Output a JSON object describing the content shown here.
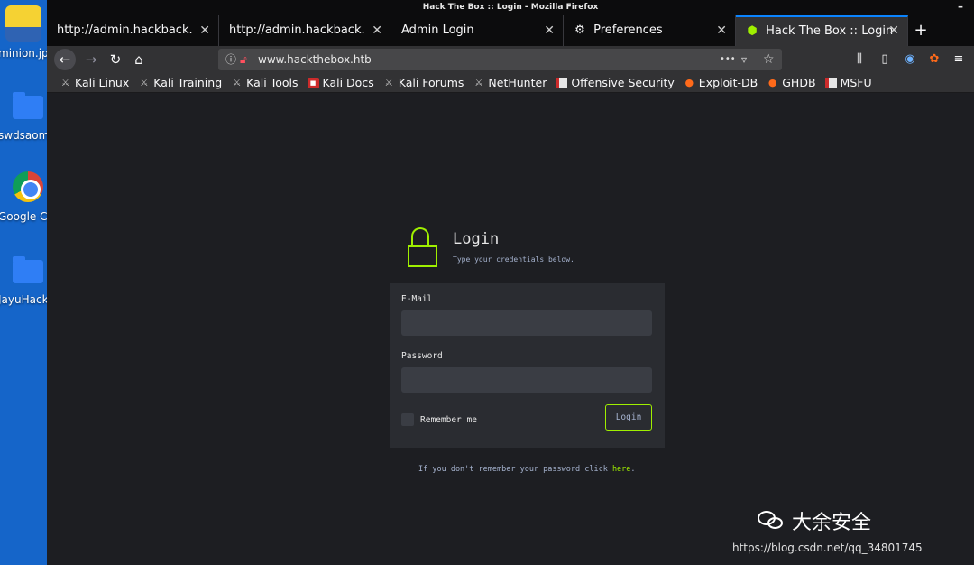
{
  "desktop": {
    "icons": [
      {
        "label": "minion.jp",
        "icon": "minion-image-icon"
      },
      {
        "label": "swdsaom",
        "icon": "folder-icon"
      },
      {
        "label": "Google Ch",
        "icon": "chrome-icon"
      },
      {
        "label": "JayuHack",
        "icon": "folder-icon"
      }
    ]
  },
  "window": {
    "title": "Hack The Box :: Login - Mozilla Firefox",
    "minimize": "–"
  },
  "tabs": [
    {
      "label": "http://admin.hackback.htb/p",
      "close": "✕"
    },
    {
      "label": "http://admin.hackback.htb/",
      "close": "✕"
    },
    {
      "label": "Admin Login",
      "close": "✕"
    },
    {
      "label": "Preferences",
      "close": "✕",
      "icon": "gear-icon"
    },
    {
      "label": "Hack The Box :: Login",
      "close": "✕",
      "active": true,
      "icon": "htb-icon"
    }
  ],
  "new_tab": "+",
  "nav": {
    "url": "www.hackthebox.htb",
    "back": "←",
    "forward": "→",
    "reload": "↻",
    "home": "⌂",
    "page_actions": "•••",
    "pocket": "▿",
    "bookmark_star": "☆"
  },
  "bookmarks": [
    {
      "label": "Kali Linux",
      "icon": "kali-icon"
    },
    {
      "label": "Kali Training",
      "icon": "kali-icon"
    },
    {
      "label": "Kali Tools",
      "icon": "kali-icon"
    },
    {
      "label": "Kali Docs",
      "icon": "docs-icon"
    },
    {
      "label": "Kali Forums",
      "icon": "kali-icon"
    },
    {
      "label": "NetHunter",
      "icon": "nethunter-icon"
    },
    {
      "label": "Offensive Security",
      "icon": "offsec-icon"
    },
    {
      "label": "Exploit-DB",
      "icon": "exploitdb-icon"
    },
    {
      "label": "GHDB",
      "icon": "ghdb-icon"
    },
    {
      "label": "MSFU",
      "icon": "msfu-icon"
    }
  ],
  "login": {
    "heading": "Login",
    "subheading": "Type your credentials below.",
    "email_label": "E-Mail",
    "email_value": "",
    "password_label": "Password",
    "password_value": "",
    "remember_label": "Remember me",
    "button_label": "Login",
    "forgot_prefix": "If you don't remember your password click ",
    "forgot_link": "here",
    "forgot_suffix": ".",
    "accent_color": "#9fef00"
  },
  "watermark": {
    "brand": "大余安全",
    "url": "https://blog.csdn.net/qq_34801745"
  }
}
